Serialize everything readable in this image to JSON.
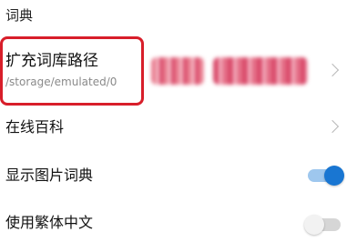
{
  "section": {
    "title": "词典"
  },
  "rows": {
    "storage": {
      "label": "扩充词库路径",
      "value": "/storage/emulated/0",
      "highlight_color": "#d81e2a"
    },
    "wiki": {
      "label": "在线百科"
    },
    "image_dict": {
      "label": "显示图片词典",
      "enabled": true
    },
    "traditional": {
      "label": "使用繁体中文",
      "enabled": false
    }
  },
  "colors": {
    "accent": "#1976d2",
    "accent_track": "#9ec7ee",
    "secondary_text": "#8a8a8a",
    "chevron": "#b8b8b8"
  },
  "icons": {
    "chevron": "chevron-right-icon"
  }
}
